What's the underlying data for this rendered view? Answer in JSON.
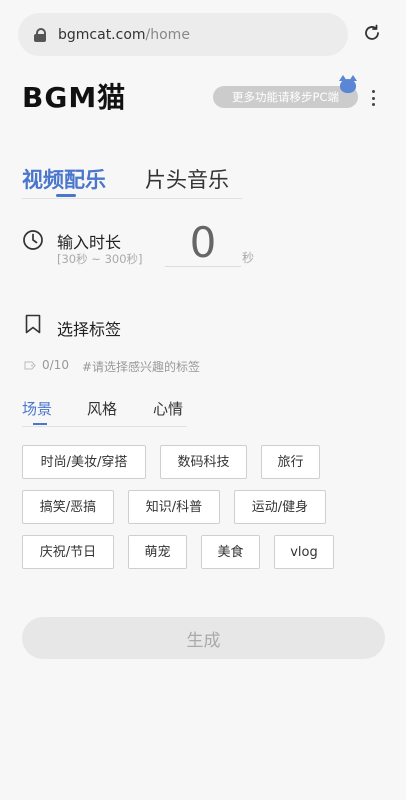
{
  "browser": {
    "domain": "bgmcat.com",
    "path": "/home"
  },
  "header": {
    "logo": "BGM猫",
    "pc_notice": "更多功能请移步PC端"
  },
  "main_tabs": [
    {
      "label": "视频配乐",
      "active": true
    },
    {
      "label": "片头音乐",
      "active": false
    }
  ],
  "duration": {
    "label": "输入时长",
    "range": "[30秒 ~ 300秒]",
    "value": "0",
    "unit": "秒"
  },
  "tags": {
    "title": "选择标签",
    "count": "0/10",
    "hint": "#请选择感兴趣的标签",
    "categories": [
      {
        "label": "场景",
        "active": true
      },
      {
        "label": "风格",
        "active": false
      },
      {
        "label": "心情",
        "active": false
      }
    ],
    "chips": [
      "时尚/美妆/穿搭",
      "数码科技",
      "旅行",
      "搞笑/恶搞",
      "知识/科普",
      "运动/健身",
      "庆祝/节日",
      "萌宠",
      "美食",
      "vlog"
    ]
  },
  "generate_label": "生成",
  "colors": {
    "accent": "#4a77cc",
    "pill_bg": "#cccccc",
    "button_bg": "#e7e7e7"
  }
}
